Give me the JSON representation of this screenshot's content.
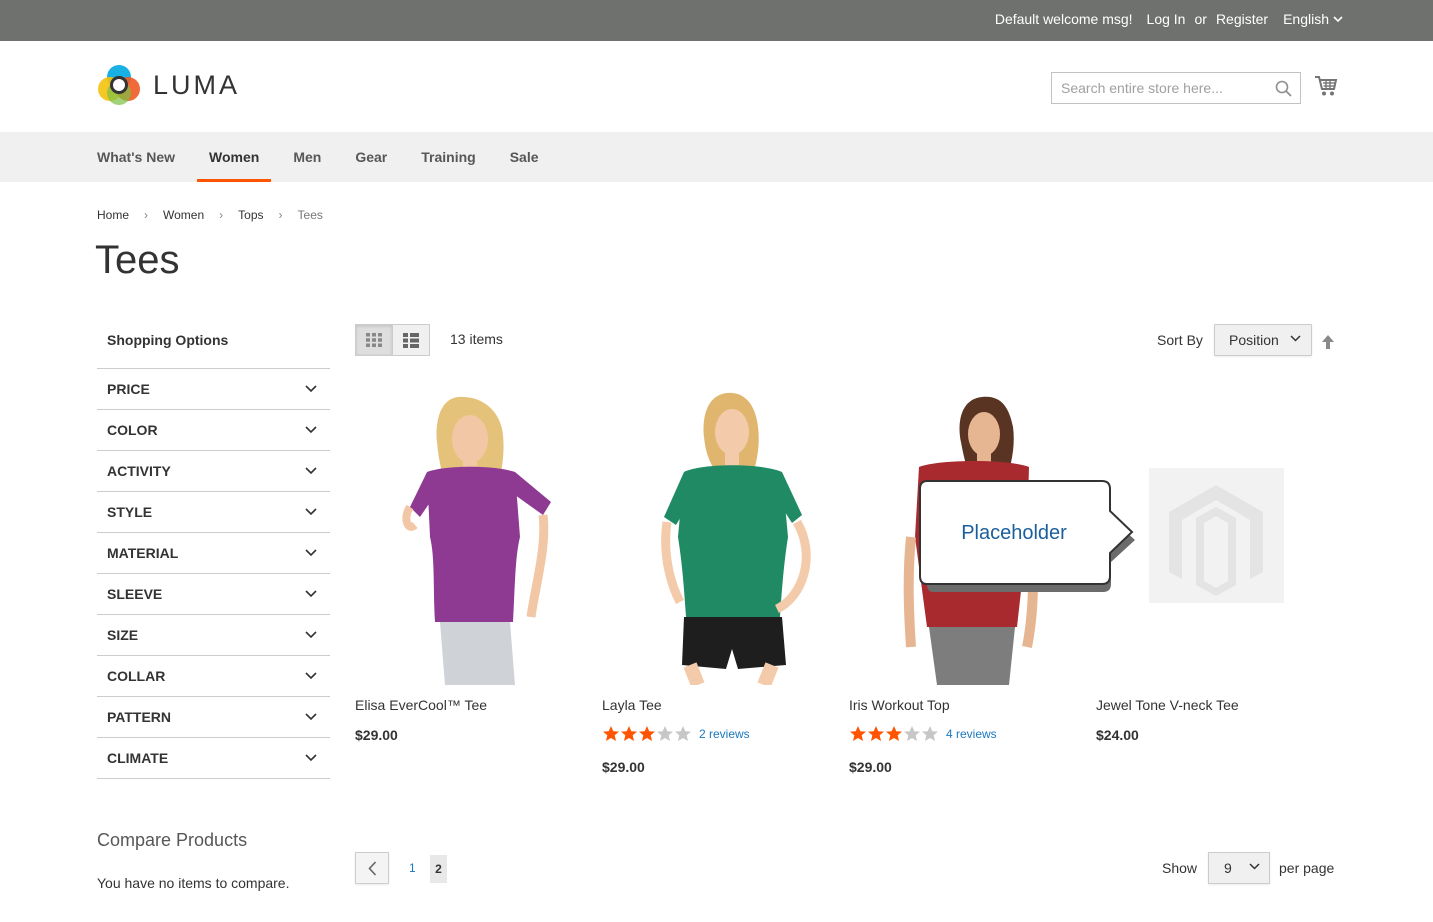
{
  "topbar": {
    "welcome": "Default welcome msg!",
    "login": "Log In",
    "or": "or",
    "register": "Register",
    "language": "English"
  },
  "header": {
    "logo_text": "LUMA",
    "search_placeholder": "Search entire store here...",
    "cart_icon": "shopping-cart-icon"
  },
  "nav": {
    "items": [
      "What's New",
      "Women",
      "Men",
      "Gear",
      "Training",
      "Sale"
    ],
    "active": "Women"
  },
  "breadcrumb": [
    "Home",
    "Women",
    "Tops",
    "Tees"
  ],
  "page_title": "Tees",
  "sidebar": {
    "title": "Shopping Options",
    "filters": [
      "PRICE",
      "COLOR",
      "ACTIVITY",
      "STYLE",
      "MATERIAL",
      "SLEEVE",
      "SIZE",
      "COLLAR",
      "PATTERN",
      "CLIMATE"
    ],
    "compare_title": "Compare Products",
    "compare_empty": "You have no items to compare."
  },
  "toolbar": {
    "item_count": "13 items",
    "sort_label": "Sort By",
    "sort_value": "Position"
  },
  "products": [
    {
      "name": "Elisa EverCool™ Tee",
      "price": "$29.00",
      "rating": null,
      "reviews": null,
      "shirt_color": "#8e3a93"
    },
    {
      "name": "Layla Tee",
      "price": "$29.00",
      "rating": 3,
      "reviews": "2 reviews",
      "shirt_color": "#1f8a64"
    },
    {
      "name": "Iris Workout Top",
      "price": "$29.00",
      "rating": 3,
      "reviews": "4 reviews",
      "shirt_color": "#a82a2f"
    },
    {
      "name": "Jewel Tone V-neck Tee",
      "price": "$24.00",
      "rating": null,
      "reviews": null,
      "shirt_color": null
    }
  ],
  "callout": {
    "text": "Placeholder"
  },
  "pager": {
    "page_1": "1",
    "page_2": "2",
    "show_label": "Show",
    "limit_value": "9",
    "per_page_label": "per page"
  },
  "colors": {
    "accent": "#ff5501",
    "link": "#1979c3",
    "topbar": "#6e716e",
    "star": "#ff5501"
  }
}
